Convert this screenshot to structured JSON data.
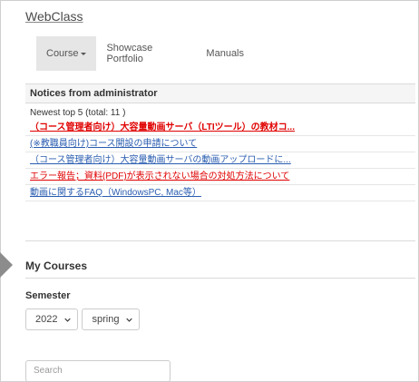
{
  "brand": "WebClass",
  "nav": {
    "course": "Course",
    "showcase": "Showcase Portfolio",
    "manuals": "Manuals"
  },
  "notices": {
    "title": "Notices from administrator",
    "newest": "Newest top 5 (total: 11 )",
    "items": [
      "（コース管理者向け）大容量動画サーバ（LTIツール）の教材コ...",
      "(※教職員向け)コース開設の申請について",
      "（コース管理者向け）大容量動画サーバの動画アップロードに...",
      "エラー報告；資料(PDF)が表示されない場合の対処方法について",
      "動画に関するFAQ（WindowsPC, Mac等）"
    ]
  },
  "courses": {
    "title": "My Courses",
    "semester_label": "Semester",
    "year_selected": "2022",
    "term_selected": "spring",
    "search_placeholder": "Search"
  },
  "colors": {
    "notice_red": "#e00000",
    "notice_blue": "#2a5db0",
    "nav_active_bg": "#e6e6e6"
  }
}
